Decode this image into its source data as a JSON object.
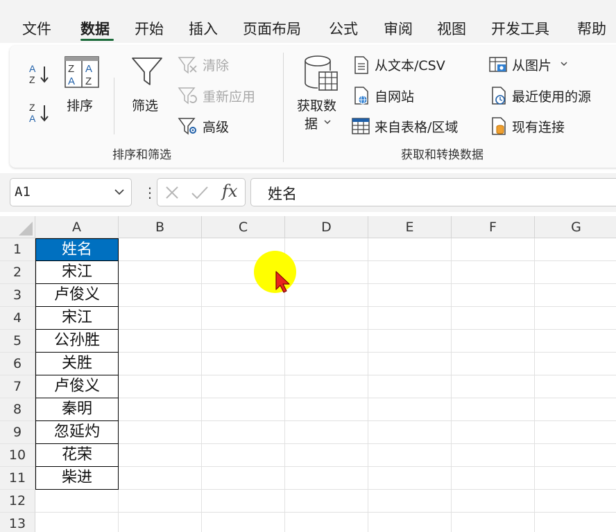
{
  "tabs": [
    "文件",
    "数据",
    "开始",
    "插入",
    "页面布局",
    "公式",
    "审阅",
    "视图",
    "开发工具",
    "帮助"
  ],
  "active_tab": "数据",
  "ribbon": {
    "sort_filter": {
      "sort_label": "排序",
      "filter_label": "筛选",
      "clear_label": "清除",
      "reapply_label": "重新应用",
      "advanced_label": "高级",
      "group_label": "排序和筛选"
    },
    "get_transform": {
      "get_data_line1": "获取数",
      "get_data_line2": "据",
      "from_text_csv": "从文本/CSV",
      "from_web": "自网站",
      "from_table_range": "来自表格/区域",
      "from_picture": "从图片",
      "recent_sources": "最近使用的源",
      "existing_connections": "现有连接",
      "group_label": "获取和转换数据"
    }
  },
  "formula_bar": {
    "name_box": "A1",
    "fx_label": "fx",
    "formula": "姓名"
  },
  "grid": {
    "columns": [
      "A",
      "B",
      "C",
      "D",
      "E",
      "F",
      "G"
    ],
    "rows": [
      "1",
      "2",
      "3",
      "4",
      "5",
      "6",
      "7",
      "8",
      "9",
      "10",
      "11",
      "12",
      "13"
    ],
    "column_a_values": [
      "姓名",
      "宋江",
      "卢俊义",
      "宋江",
      "公孙胜",
      "关胜",
      "卢俊义",
      "秦明",
      "忽延灼",
      "花荣",
      "柴进"
    ]
  },
  "colors": {
    "header_fill": "#0070c0",
    "active_tab_underline": "#1b6b3a",
    "pointer_highlight": "#ffff00",
    "cursor": "#e8261c"
  }
}
